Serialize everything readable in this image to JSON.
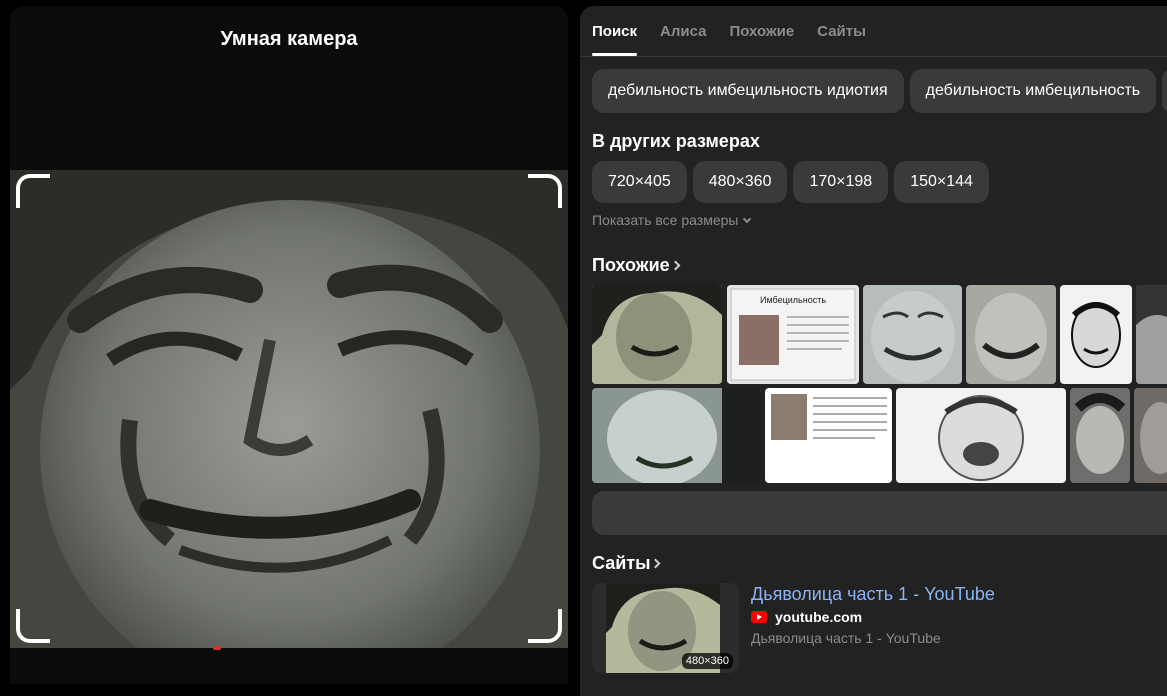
{
  "camera": {
    "title": "Умная камера"
  },
  "tabs": [
    {
      "label": "Поиск",
      "active": true
    },
    {
      "label": "Алиса",
      "active": false
    },
    {
      "label": "Похожие",
      "active": false
    },
    {
      "label": "Сайты",
      "active": false
    }
  ],
  "query_chips": [
    "дебильность имбецильность идиотия",
    "дебильность имбецильность"
  ],
  "sizes": {
    "title": "В других размерах",
    "items": [
      "720×405",
      "480×360",
      "170×198",
      "150×144"
    ],
    "show_all": "Показать все размеры"
  },
  "similar": {
    "title": "Похожие",
    "doc_title": "Имбецильность"
  },
  "sites": {
    "title": "Сайты",
    "result": {
      "title": "Дьяволица часть 1 - YouTube",
      "domain": "youtube.com",
      "description": "Дьяволица часть 1 - YouTube",
      "badge": "480×360"
    }
  },
  "colors": {
    "background": "#000000",
    "panel": "#222222",
    "chip": "#3a3a3a",
    "link": "#8ab4f8",
    "muted": "#8c8c8c",
    "youtube": "#ff0000"
  }
}
